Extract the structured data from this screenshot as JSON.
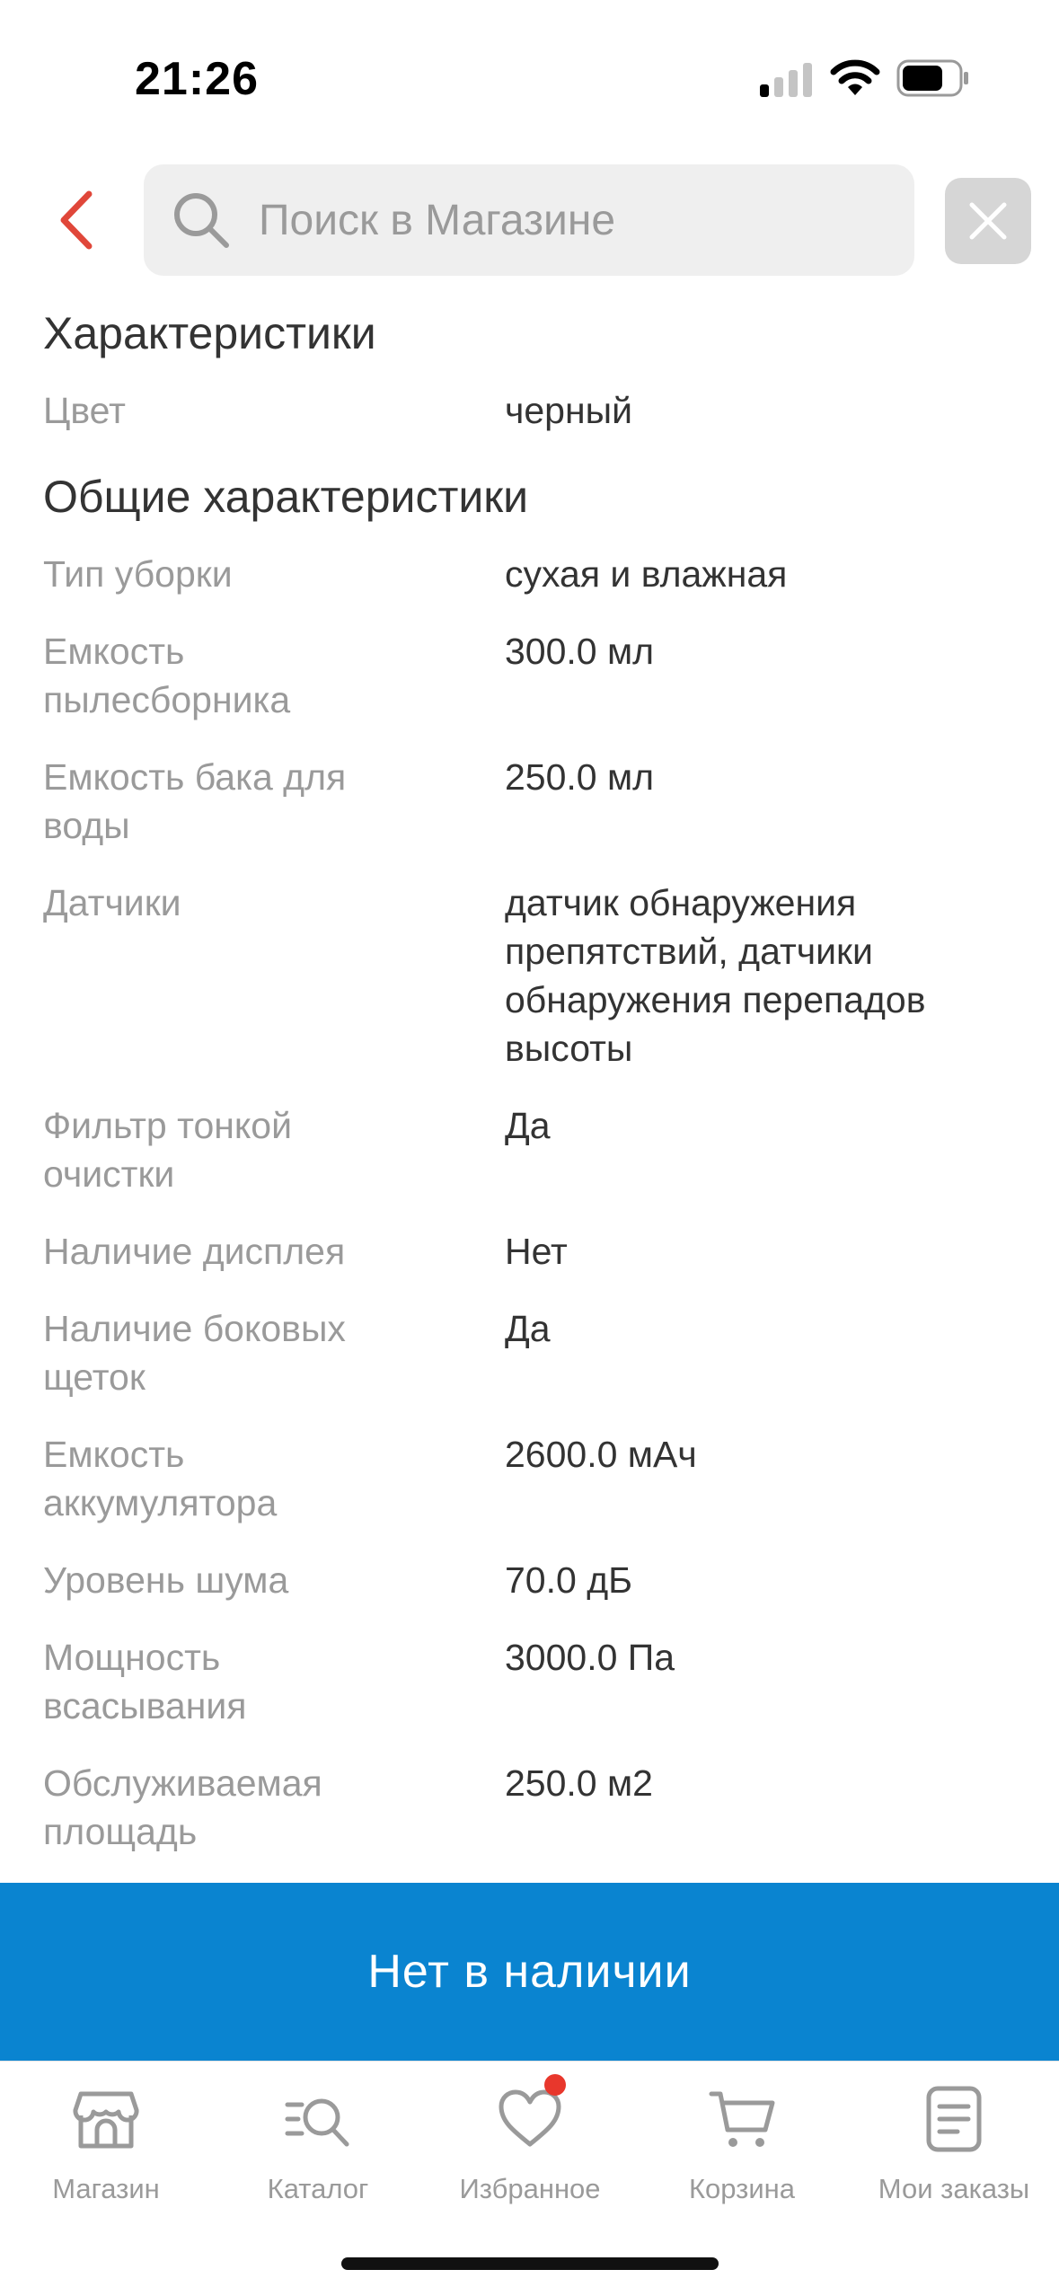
{
  "status_bar": {
    "time": "21:26"
  },
  "search": {
    "placeholder": "Поиск в Магазине",
    "value": ""
  },
  "sections": [
    {
      "title": "Характеристики"
    },
    {
      "title": "Общие характеристики"
    }
  ],
  "rows": [
    {
      "label": "Цвет",
      "value": "черный"
    },
    {
      "label": "Тип уборки",
      "value": "сухая и влажная"
    },
    {
      "label": "Емкость пылесборника",
      "value": "300.0 мл"
    },
    {
      "label": "Емкость бака для воды",
      "value": "250.0 мл"
    },
    {
      "label": "Датчики",
      "value": "датчик обнаружения препятствий, датчики обнаружения перепадов высоты"
    },
    {
      "label": "Фильтр тонкой очистки",
      "value": "Да"
    },
    {
      "label": "Наличие дисплея",
      "value": "Нет"
    },
    {
      "label": "Наличие боковых щеток",
      "value": "Да"
    },
    {
      "label": "Емкость аккумулятора",
      "value": "2600.0 мАч"
    },
    {
      "label": "Уровень шума",
      "value": "70.0 дБ"
    },
    {
      "label": "Мощность всасывания",
      "value": "3000.0 Па"
    },
    {
      "label": "Обслуживаемая площадь",
      "value": "250.0 м2"
    }
  ],
  "cta": {
    "label": "Нет в наличии"
  },
  "tabs": [
    {
      "label": "Магазин",
      "icon": "store-icon"
    },
    {
      "label": "Каталог",
      "icon": "catalog-search-icon"
    },
    {
      "label": "Избранное",
      "icon": "heart-icon",
      "badge": true
    },
    {
      "label": "Корзина",
      "icon": "cart-icon"
    },
    {
      "label": "Мои заказы",
      "icon": "orders-icon"
    }
  ],
  "colors": {
    "accent_red": "#e0473a",
    "cta_blue": "#0a84d0",
    "label_gray": "#9a9a9a",
    "text_dark": "#333333",
    "badge_red": "#e8372c"
  }
}
